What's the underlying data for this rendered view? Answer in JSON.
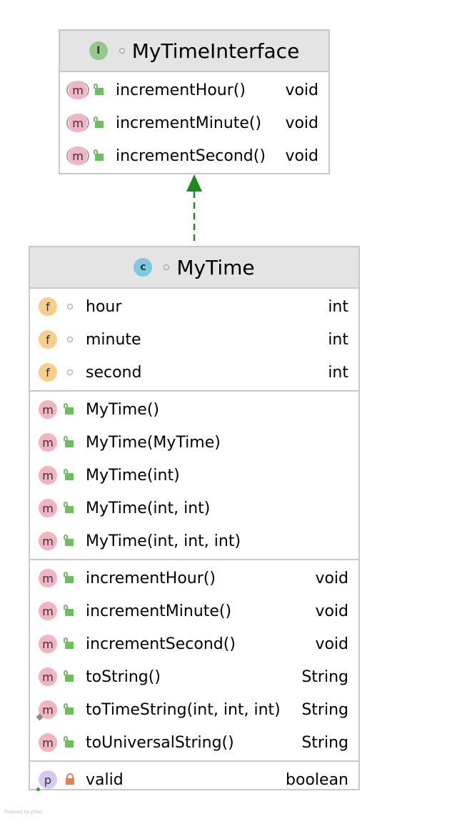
{
  "interface": {
    "kind_letter": "I",
    "title": "MyTimeInterface",
    "methods": [
      {
        "name": "incrementHour()",
        "type": "void"
      },
      {
        "name": "incrementMinute()",
        "type": "void"
      },
      {
        "name": "incrementSecond()",
        "type": "void"
      }
    ]
  },
  "class": {
    "kind_letter": "c",
    "title": "MyTime",
    "fields": [
      {
        "badge": "f",
        "name": "hour",
        "type": "int"
      },
      {
        "badge": "f",
        "name": "minute",
        "type": "int"
      },
      {
        "badge": "f",
        "name": "second",
        "type": "int"
      }
    ],
    "constructors": [
      {
        "badge": "m",
        "name": "MyTime()"
      },
      {
        "badge": "m",
        "name": "MyTime(MyTime)"
      },
      {
        "badge": "m",
        "name": "MyTime(int)"
      },
      {
        "badge": "m",
        "name": "MyTime(int, int)"
      },
      {
        "badge": "m",
        "name": "MyTime(int, int, int)"
      }
    ],
    "methods": [
      {
        "badge": "m",
        "name": "incrementHour()",
        "type": "void"
      },
      {
        "badge": "m",
        "name": "incrementMinute()",
        "type": "void"
      },
      {
        "badge": "m",
        "name": "incrementSecond()",
        "type": "void"
      },
      {
        "badge": "m",
        "name": "toString()",
        "type": "String"
      },
      {
        "badge": "m",
        "name": "toTimeString(int, int, int)",
        "type": "String"
      },
      {
        "badge": "m",
        "name": "toUniversalString()",
        "type": "String"
      }
    ],
    "properties": [
      {
        "badge": "p",
        "name": "valid",
        "type": "boolean"
      }
    ]
  },
  "footer": "Powered by yFiles",
  "colors": {
    "header_bg": "#e4e4e4",
    "border": "#c8c8c8",
    "implements_arrow": "#1b8a1b",
    "method_badge": "#f3b3c0",
    "field_badge": "#f7cf8a",
    "property_badge": "#d7c8f2",
    "interface_badge": "#95c98a",
    "class_badge": "#7ec8e3"
  }
}
